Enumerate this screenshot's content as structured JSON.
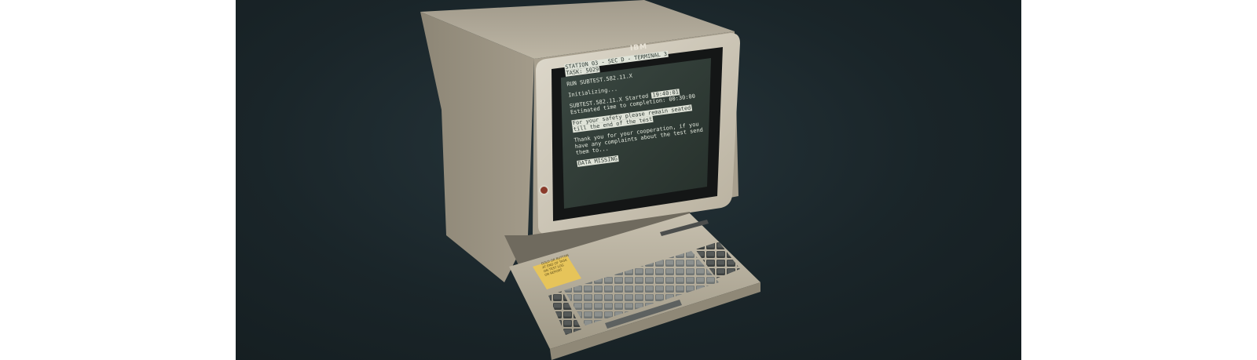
{
  "terminal": {
    "brand": "IBM",
    "screen_lines": {
      "station": "STATION 03 - SEC D - TERMINAL 3",
      "task": "TASK: 5029",
      "command": "RUN SUBTEST.582.11.X",
      "initializing": "Initializing...",
      "started": "SUBTEST.582.11.X Started",
      "started_highlight": "19:40:01",
      "estimated": "Estimated time to completion: 00:30:00",
      "safety_1": "For your safety please remain seated",
      "safety_2": "till the end of the test",
      "thanks_1": "Thank you for your cooperation, if you",
      "thanks_2": "have any complaints about the test send",
      "thanks_3": "them to...",
      "data_missing": "DATA MISSING"
    },
    "sticky_note": {
      "line1": "GOLD OR BUTTON",
      "line2": "AT END OF TASK",
      "line3": "ON TEST LOG",
      "line4": "OR REPORT"
    }
  },
  "colors": {
    "background": "#1a2529",
    "case": "#b5ad9c",
    "screen": "#2f3a34",
    "screen_text": "#e3e8dd",
    "note": "#e6c45a"
  },
  "icons": [
    "power-switch-icon"
  ]
}
